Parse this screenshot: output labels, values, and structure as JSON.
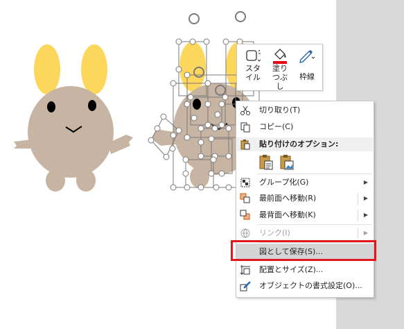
{
  "mini_toolbar": {
    "style_label": "スタイル",
    "fill_label": "塗りつぶし",
    "outline_label": "枠線",
    "fill_color": "#e60012"
  },
  "context_menu": {
    "items": [
      {
        "label": "切り取り(T)",
        "icon": "scissors-icon"
      },
      {
        "label": "コピー(C)",
        "icon": "copy-icon"
      },
      {
        "label": "貼り付けのオプション:",
        "icon": "paste-icon"
      },
      {
        "label": "グループ化(G)",
        "icon": "group-icon",
        "submenu": true
      },
      {
        "label": "最前面へ移動(R)",
        "icon": "bring-to-front-icon",
        "submenu": true
      },
      {
        "label": "最背面へ移動(K)",
        "icon": "send-to-back-icon",
        "submenu": true
      },
      {
        "label": "リンク(I)",
        "icon": "link-icon",
        "submenu": true,
        "disabled": true
      },
      {
        "label": "図として保存(S)...",
        "icon": "",
        "highlighted": true
      },
      {
        "label": "配置とサイズ(Z)...",
        "icon": "size-position-icon"
      },
      {
        "label": "オブジェクトの書式設定(O)...",
        "icon": "format-object-icon"
      }
    ]
  },
  "colors": {
    "character_body": "#c8b4a3",
    "character_ears": "#fdd65c",
    "highlight_outline": "#e3161c",
    "side_panel": "#d9d9d9"
  }
}
